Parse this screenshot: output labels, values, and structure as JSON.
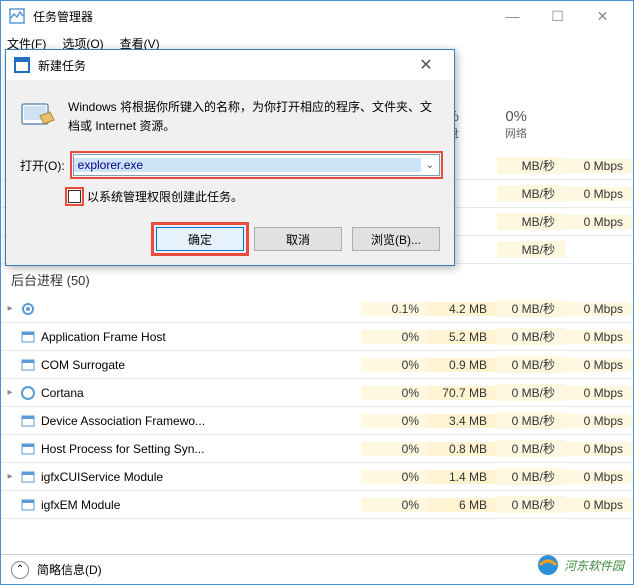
{
  "window": {
    "title": "任务管理器",
    "menu": {
      "file": "文件(F)",
      "options": "选项(O)",
      "view": "查看(V)"
    }
  },
  "headers": {
    "cpu_pct": "0%",
    "cpu_lbl": "磁盘",
    "net_pct": "0%",
    "net_lbl": "网络"
  },
  "dialog": {
    "title": "新建任务",
    "message": "Windows 将根据你所键入的名称，为你打开相应的程序、文件夹、文档或 Internet 资源。",
    "open_label": "打开(O):",
    "input_value": "explorer.exe",
    "admin_label": "以系统管理权限创建此任务。",
    "ok": "确定",
    "cancel": "取消",
    "browse": "浏览(B)..."
  },
  "category": "后台进程 (50)",
  "rows": [
    {
      "name": "",
      "cpu": "",
      "mem": "",
      "disk": "MB/秒",
      "net": "0 Mbps"
    },
    {
      "name": "",
      "cpu": "",
      "mem": "",
      "disk": "MB/秒",
      "net": "0 Mbps"
    },
    {
      "name": "",
      "cpu": "",
      "mem": "",
      "disk": "MB/秒",
      "net": "0 Mbps"
    },
    {
      "name": "",
      "cpu": "",
      "mem": "",
      "disk": "MB/秒",
      "net": ""
    }
  ],
  "procs": [
    {
      "name": "",
      "cpu": "0.1%",
      "mem": "4.2 MB",
      "disk": "0 MB/秒",
      "net": "0 Mbps",
      "exp": true,
      "icon": "gear"
    },
    {
      "name": "Application Frame Host",
      "cpu": "0%",
      "mem": "5.2 MB",
      "disk": "0 MB/秒",
      "net": "0 Mbps",
      "icon": "app"
    },
    {
      "name": "COM Surrogate",
      "cpu": "0%",
      "mem": "0.9 MB",
      "disk": "0 MB/秒",
      "net": "0 Mbps",
      "icon": "app"
    },
    {
      "name": "Cortana",
      "cpu": "0%",
      "mem": "70.7 MB",
      "disk": "0 MB/秒",
      "net": "0 Mbps",
      "exp": true,
      "icon": "circle"
    },
    {
      "name": "Device Association Framewo...",
      "cpu": "0%",
      "mem": "3.4 MB",
      "disk": "0 MB/秒",
      "net": "0 Mbps",
      "icon": "app"
    },
    {
      "name": "Host Process for Setting Syn...",
      "cpu": "0%",
      "mem": "0.8 MB",
      "disk": "0 MB/秒",
      "net": "0 Mbps",
      "icon": "app"
    },
    {
      "name": "igfxCUIService Module",
      "cpu": "0%",
      "mem": "1.4 MB",
      "disk": "0 MB/秒",
      "net": "0 Mbps",
      "exp": true,
      "icon": "app"
    },
    {
      "name": "igfxEM Module",
      "cpu": "0%",
      "mem": "6 MB",
      "disk": "0 MB/秒",
      "net": "0 Mbps",
      "icon": "app"
    }
  ],
  "footer": {
    "brief": "简略信息(D)"
  },
  "watermark": "河东软件园"
}
